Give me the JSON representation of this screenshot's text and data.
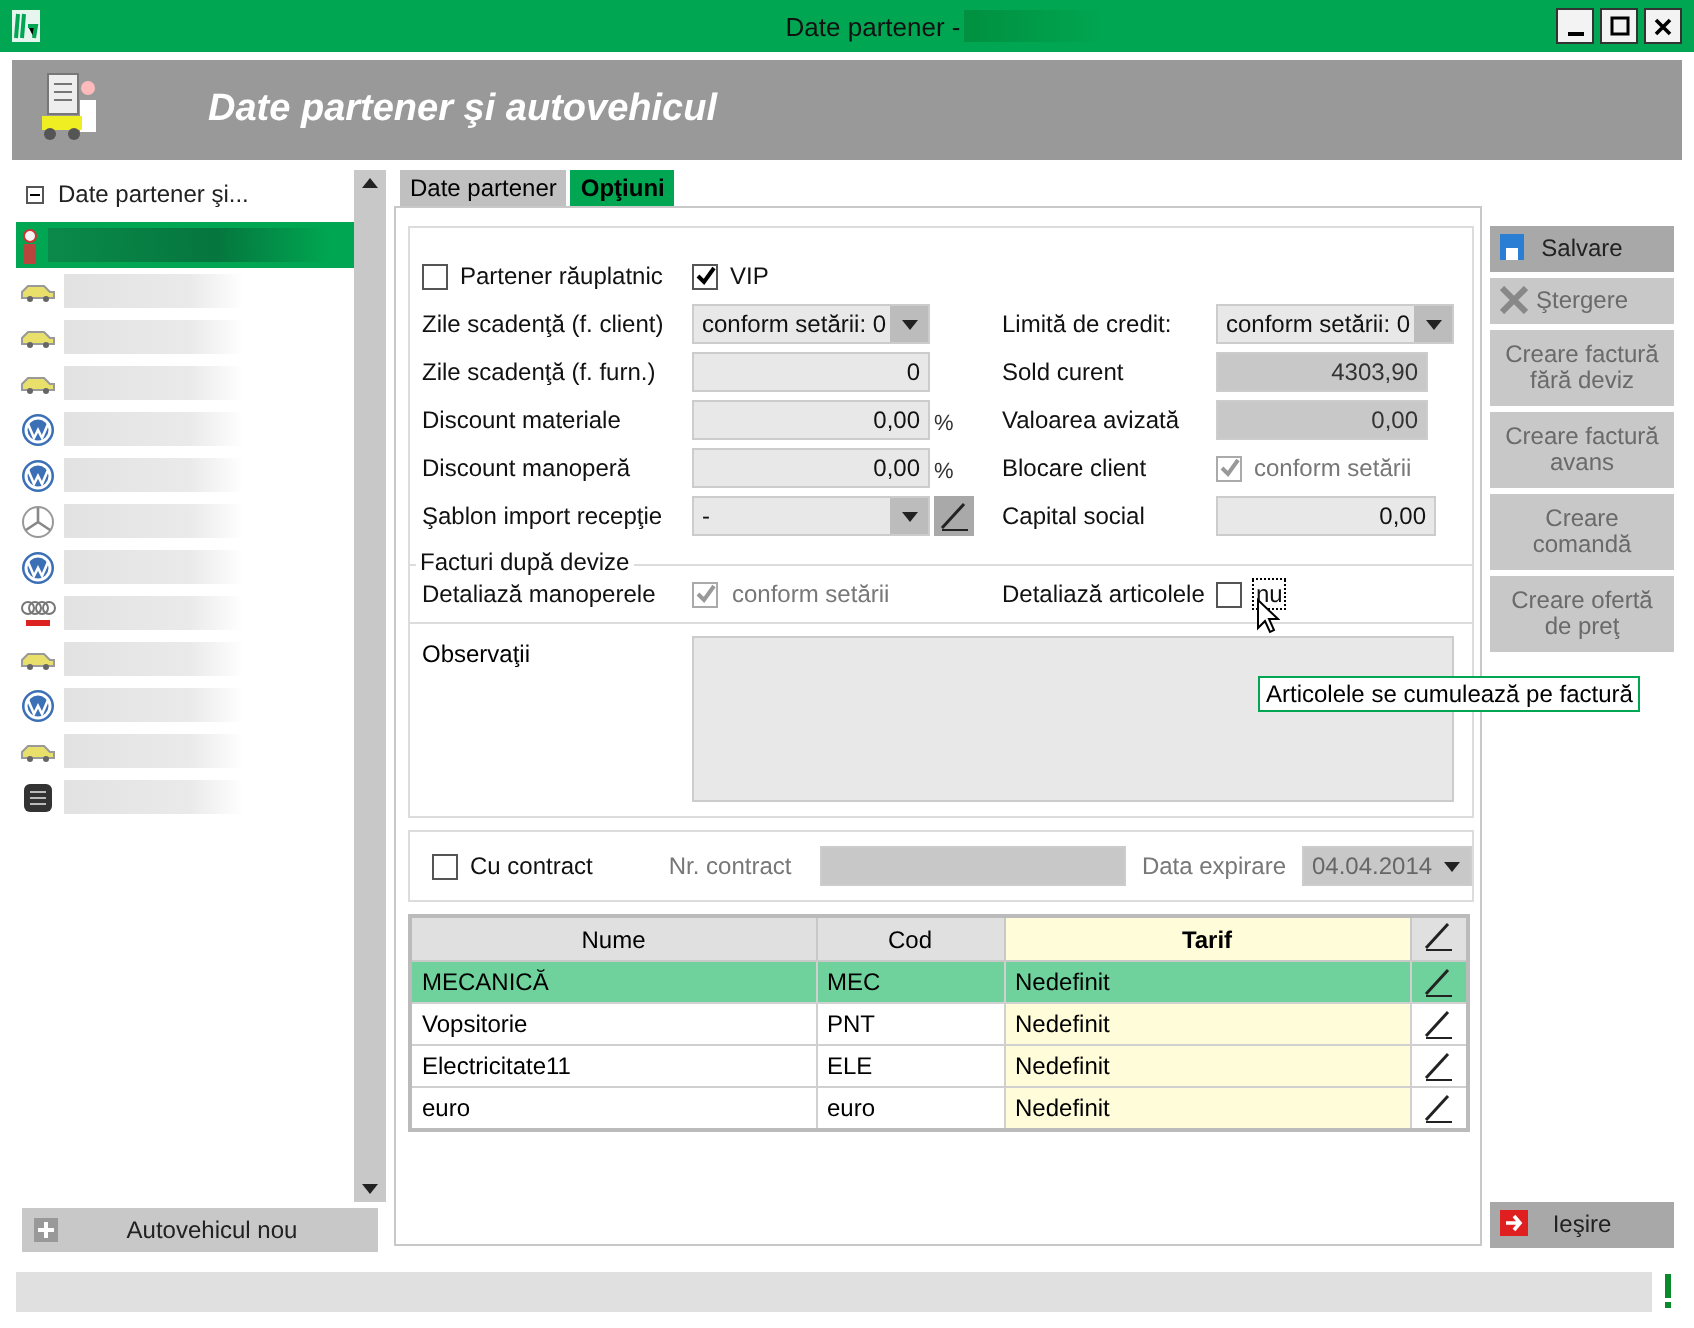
{
  "window": {
    "title": "Date partener -"
  },
  "header": {
    "title": "Date partener şi autovehicul"
  },
  "tree": {
    "label": "Date partener şi...",
    "expanded": true,
    "children": [
      {
        "kind": "partner",
        "selected": true
      },
      {
        "kind": "car",
        "selected": false
      },
      {
        "kind": "car",
        "selected": false
      },
      {
        "kind": "car",
        "selected": false
      },
      {
        "kind": "round-emblem",
        "selected": false
      },
      {
        "kind": "round-emblem",
        "selected": false
      },
      {
        "kind": "star-emblem",
        "selected": false
      },
      {
        "kind": "round-emblem",
        "selected": false
      },
      {
        "kind": "rings-emblem",
        "selected": false
      },
      {
        "kind": "car",
        "selected": false
      },
      {
        "kind": "round-emblem",
        "selected": false
      },
      {
        "kind": "car",
        "selected": false
      },
      {
        "kind": "dark-emblem",
        "selected": false
      }
    ]
  },
  "new_vehicle_button": "Autovehicul nou",
  "tabs": [
    {
      "label": "Date partener",
      "selected": false
    },
    {
      "label": "Opţiuni",
      "selected": true
    }
  ],
  "flags": [
    {
      "label": "Partener răuplatnic",
      "checked": false
    },
    {
      "label": "VIP",
      "checked": true
    }
  ],
  "left_fields": [
    {
      "label": "Zile scadenţă (f. client)",
      "kind": "dropdown",
      "value": "conform setării: 0"
    },
    {
      "label": "Zile scadenţă (f. furn.)",
      "kind": "field",
      "value": "0",
      "disabled": false
    },
    {
      "label": "Discount materiale",
      "kind": "field",
      "value": "0,00",
      "unit": "%",
      "disabled": false
    },
    {
      "label": "Discount manoperă",
      "kind": "field",
      "value": "0,00",
      "unit": "%",
      "disabled": false
    },
    {
      "label": "Şablon import recepţie",
      "kind": "dropdown-edit",
      "value": "-"
    }
  ],
  "right_fields": [
    {
      "label": "Limită de credit:",
      "kind": "dropdown",
      "value": "conform setării: 0"
    },
    {
      "label": "Sold curent",
      "kind": "field",
      "value": "4303,90",
      "disabled": true
    },
    {
      "label": "Valoarea avizată",
      "kind": "field",
      "value": "0,00",
      "disabled": true
    },
    {
      "label": "Blocare client",
      "kind": "checkbox",
      "text": "conform setării",
      "checked": true,
      "disabled": true
    },
    {
      "label": "Capital social",
      "kind": "field",
      "value": "0,00",
      "disabled": false
    }
  ],
  "invoice_group": {
    "title": "Facturi după devize",
    "items": [
      {
        "label": "Detaliază manoperele",
        "text": "conform setării",
        "checked": true,
        "disabled": true,
        "focused": false
      },
      {
        "label": "Detaliază articolele",
        "text": "nu",
        "checked": false,
        "disabled": false,
        "focused": true
      }
    ]
  },
  "notes": {
    "label": "Observaţii"
  },
  "tooltip": "Articolele se cumulează pe factură",
  "contract": {
    "label": "Cu contract",
    "checked": false,
    "number_label": "Nr. contract",
    "date_label": "Data expirare",
    "date": "04.04.2014",
    "disabled": true
  },
  "table": {
    "columns": [
      "Nume",
      "Cod",
      "Tarif"
    ],
    "rows": [
      {
        "cells": [
          "MECANICĂ",
          "MEC",
          "Nedefinit"
        ],
        "selected": true
      },
      {
        "cells": [
          "Vopsitorie",
          "PNT",
          "Nedefinit"
        ],
        "selected": false
      },
      {
        "cells": [
          "Electricitate11",
          "ELE",
          "Nedefinit"
        ],
        "selected": false
      },
      {
        "cells": [
          "euro",
          "euro",
          "Nedefinit"
        ],
        "selected": false
      }
    ]
  },
  "actions": [
    {
      "label": "Salvare",
      "kind": "save",
      "disabled": false
    },
    {
      "label": "Ştergere",
      "kind": "delete",
      "disabled": true
    },
    {
      "label": "Creare factură fără deviz",
      "kind": "text",
      "disabled": true
    },
    {
      "label": "Creare factură avans",
      "kind": "text",
      "disabled": true
    },
    {
      "label": "Creare comandă",
      "kind": "text",
      "disabled": true
    },
    {
      "label": "Creare ofertă de preţ",
      "kind": "text",
      "disabled": true
    }
  ],
  "exit_button": "Ieşire"
}
